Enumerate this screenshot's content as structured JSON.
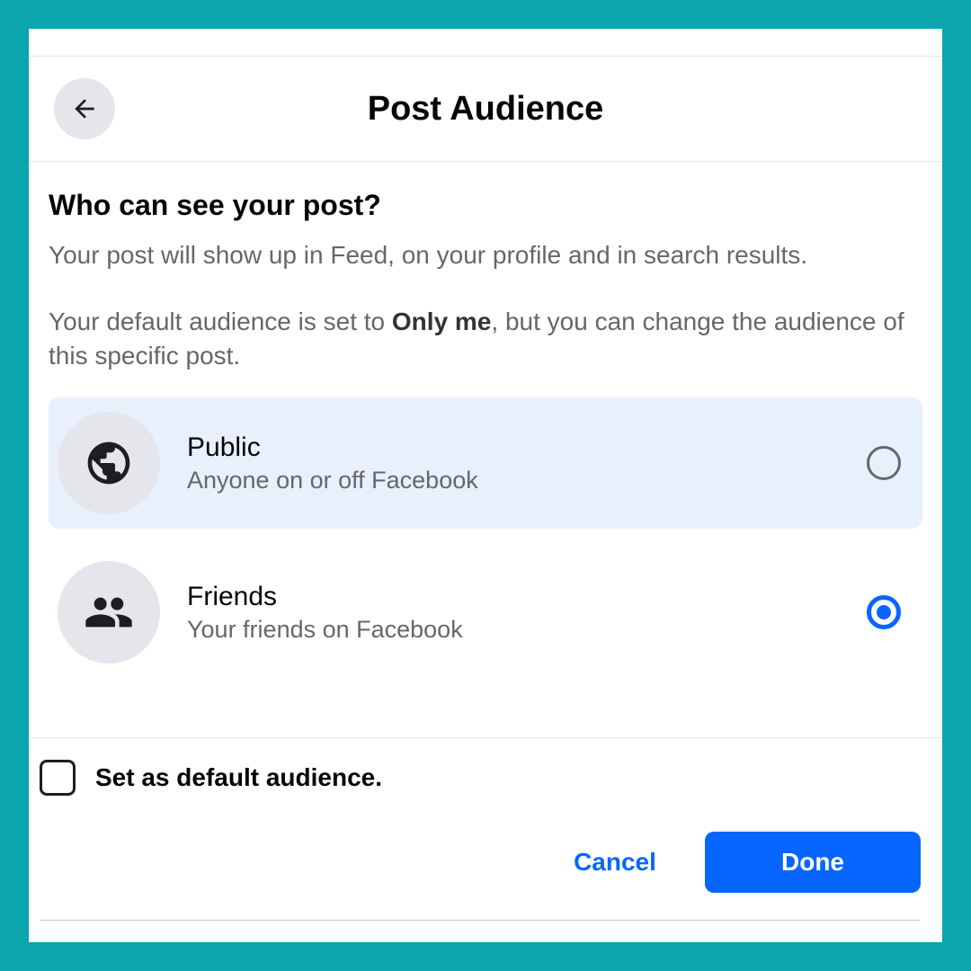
{
  "header": {
    "title": "Post Audience"
  },
  "question": "Who can see your post?",
  "description1": "Your post will show up in Feed, on your profile and in search results.",
  "description2_prefix": "Your default audience is set to ",
  "description2_bold": "Only me",
  "description2_suffix": ", but you can change the audience of this specific post.",
  "options": [
    {
      "title": "Public",
      "subtitle": "Anyone on or off Facebook",
      "selected": false,
      "highlight": true,
      "icon": "globe"
    },
    {
      "title": "Friends",
      "subtitle": "Your friends on Facebook",
      "selected": true,
      "highlight": false,
      "icon": "friends"
    }
  ],
  "default_checkbox": {
    "label": "Set as default audience.",
    "checked": false
  },
  "buttons": {
    "cancel": "Cancel",
    "done": "Done"
  }
}
